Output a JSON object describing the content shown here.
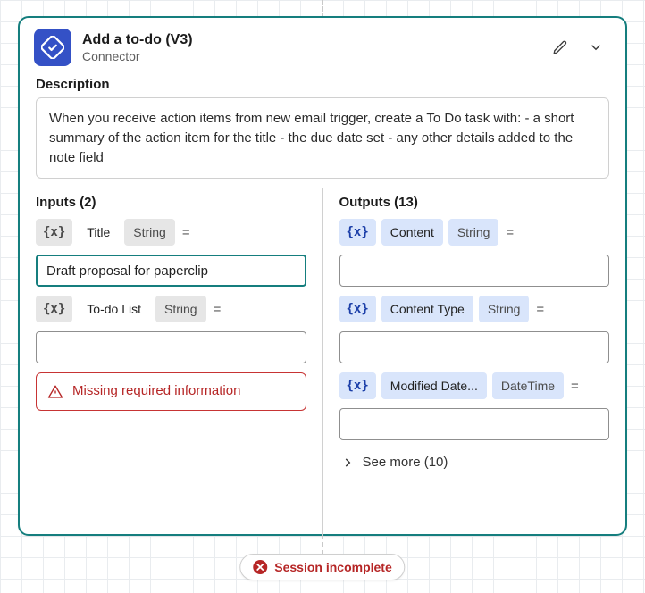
{
  "card": {
    "title": "Add a to-do (V3)",
    "subtitle": "Connector",
    "descriptionLabel": "Description",
    "description": "When you receive action items from new email trigger, create a To Do task with: - a short summary of the action item for the title - the due date set - any other details added to the note field"
  },
  "inputs": {
    "heading": "Inputs (2)",
    "items": [
      {
        "badge": "{x}",
        "name": "Title",
        "type": "String",
        "value": "Draft proposal for paperclip",
        "selected": true
      },
      {
        "badge": "{x}",
        "name": "To-do List",
        "type": "String",
        "value": ""
      }
    ],
    "error": "Missing required information"
  },
  "outputs": {
    "heading": "Outputs (13)",
    "items": [
      {
        "badge": "{x}",
        "name": "Content",
        "type": "String",
        "value": ""
      },
      {
        "badge": "{x}",
        "name": "Content Type",
        "type": "String",
        "value": ""
      },
      {
        "badge": "{x}",
        "name": "Modified Date...",
        "type": "DateTime",
        "value": ""
      }
    ],
    "seeMore": "See more (10)"
  },
  "status": {
    "label": "Session incomplete"
  }
}
